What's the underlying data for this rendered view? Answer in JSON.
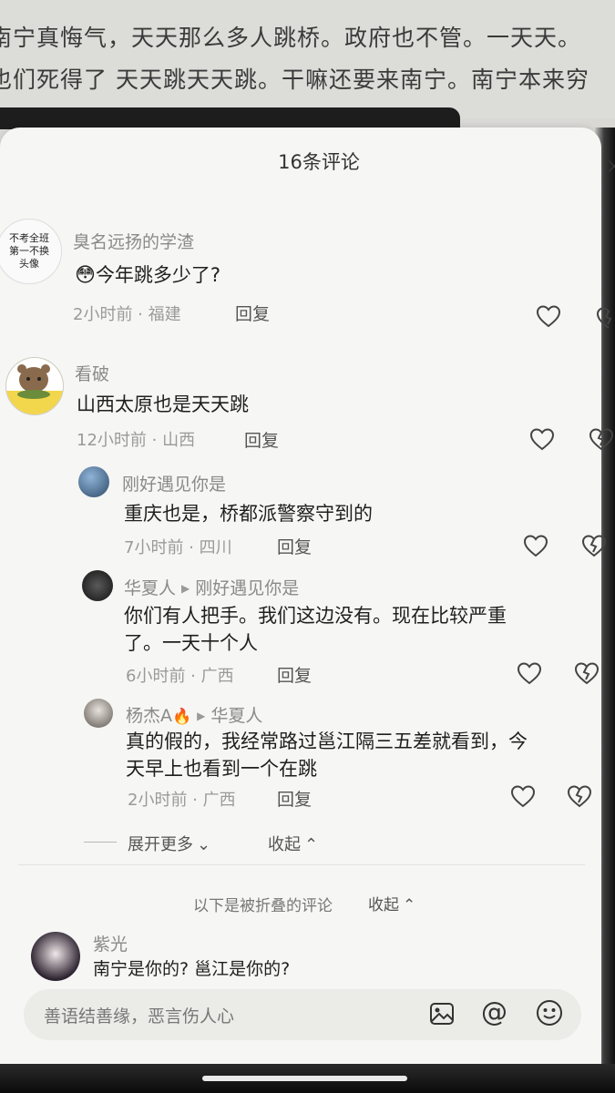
{
  "post": {
    "line1": "南宁真悔气，天天那么多人跳桥。政府也不管。一天天。",
    "line2": "也们死得了 天天跳天天跳。干嘛还要来南宁。南宁本来穷"
  },
  "sheet": {
    "title": "16条评论",
    "close": "×"
  },
  "comments": [
    {
      "author": "臭名远扬的学渣",
      "avatar_text": [
        "不考全班",
        "第一不换",
        "头像"
      ],
      "emoji": "😳",
      "content": "今年跳多少了?",
      "meta": "2小时前 · 福建",
      "reply": "回复"
    },
    {
      "author": "看破",
      "content": "山西太原也是天天跳",
      "meta": "12小时前 · 山西",
      "reply": "回复"
    }
  ],
  "replies": [
    {
      "author": "刚好遇见你是",
      "content": [
        "重庆也是，桥都派警察守到的"
      ],
      "meta": "7小时前 · 四川",
      "reply": "回复"
    },
    {
      "author": "华夏人",
      "reply_to": "刚好遇见你是",
      "content": [
        "你们有人把手。我们这边没有。现在比较严重",
        "了。一天十个人"
      ],
      "meta": "6小时前 · 广西",
      "reply": "回复"
    },
    {
      "author": "杨杰A",
      "author_emoji": "🔥",
      "reply_to": "华夏人",
      "content": [
        "真的假的，我经常路过邕江隔三五差就看到，今",
        "天早上也看到一个在跳"
      ],
      "meta": "2小时前 · 广西",
      "reply": "回复"
    }
  ],
  "thread_controls": {
    "expand_more": "展开更多",
    "collapse": "收起"
  },
  "folded": {
    "note": "以下是被折叠的评论",
    "collapse": "收起",
    "comment": {
      "author": "紫光",
      "content": "南宁是你的? 邕江是你的?"
    }
  },
  "input": {
    "placeholder": "善语结善缘，恶言伤人心"
  },
  "icons": {
    "like": "heart-outline-icon",
    "dislike": "broken-heart-icon",
    "image": "image-icon",
    "mention": "at-icon",
    "emoji": "smiley-icon"
  }
}
